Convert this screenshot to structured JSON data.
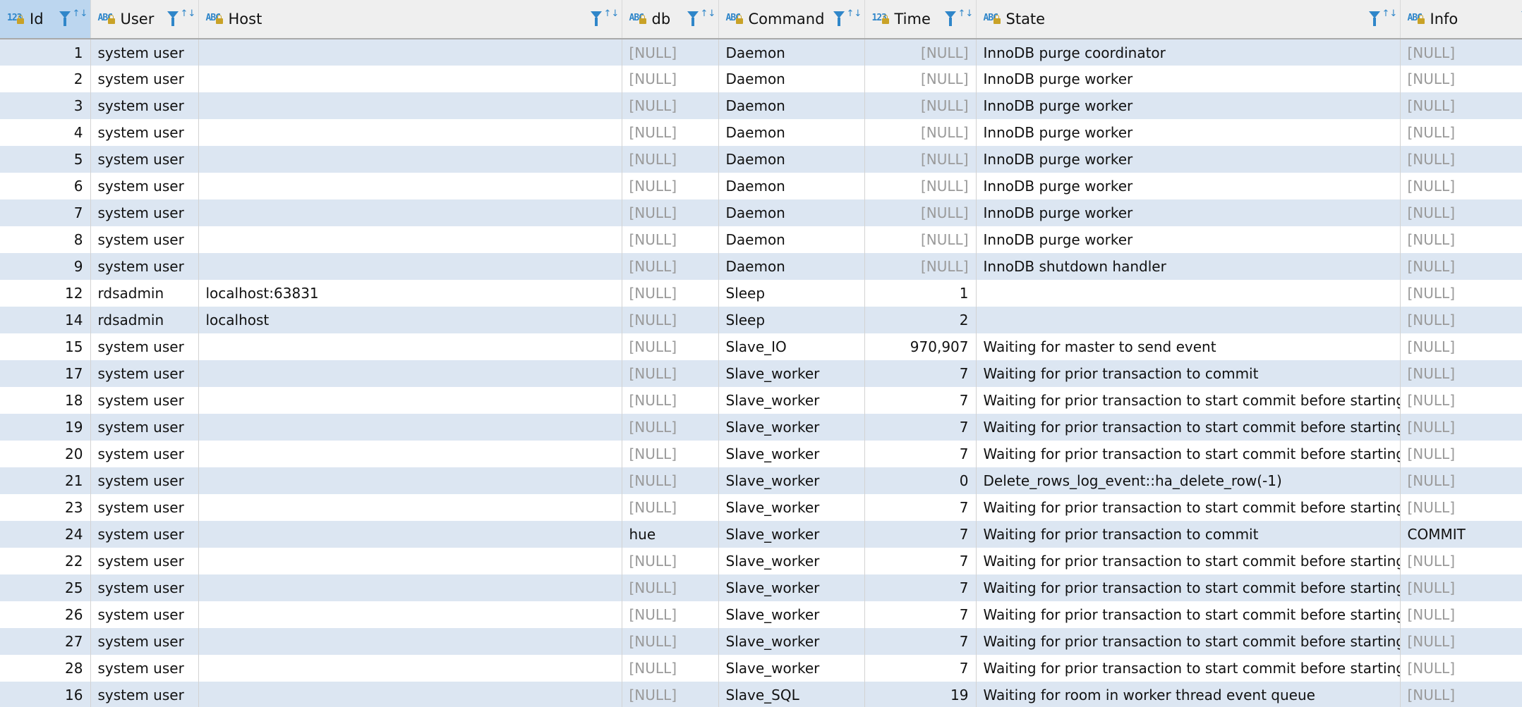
{
  "columns": [
    {
      "key": "id",
      "label": "Id",
      "type_glyph": "123",
      "align": "right",
      "active": true
    },
    {
      "key": "user",
      "label": "User",
      "type_glyph": "ABC",
      "align": "left"
    },
    {
      "key": "host",
      "label": "Host",
      "type_glyph": "ABC",
      "align": "left"
    },
    {
      "key": "db",
      "label": "db",
      "type_glyph": "ABC",
      "align": "left"
    },
    {
      "key": "command",
      "label": "Command",
      "type_glyph": "ABC",
      "align": "left"
    },
    {
      "key": "time",
      "label": "Time",
      "type_glyph": "123",
      "align": "right"
    },
    {
      "key": "state",
      "label": "State",
      "type_glyph": "ABC",
      "align": "left"
    },
    {
      "key": "info",
      "label": "Info",
      "type_glyph": "ABC",
      "align": "left"
    }
  ],
  "null_text": "[NULL]",
  "icons": {
    "lock": "lock-icon",
    "filter": "filter-icon",
    "sort": "sort-icon",
    "sort_arrows": "↑↓"
  },
  "colors": {
    "accent": "#2f86c9",
    "row_alt": "#dce6f2",
    "header_bg": "#efefef",
    "active_header": "#bcd6ef",
    "null_text": "#9a9a9a"
  },
  "rows": [
    {
      "id": "1",
      "user": "system user",
      "host": "",
      "db": null,
      "command": "Daemon",
      "time": null,
      "state": "InnoDB purge coordinator",
      "info": null
    },
    {
      "id": "2",
      "user": "system user",
      "host": "",
      "db": null,
      "command": "Daemon",
      "time": null,
      "state": "InnoDB purge worker",
      "info": null
    },
    {
      "id": "3",
      "user": "system user",
      "host": "",
      "db": null,
      "command": "Daemon",
      "time": null,
      "state": "InnoDB purge worker",
      "info": null
    },
    {
      "id": "4",
      "user": "system user",
      "host": "",
      "db": null,
      "command": "Daemon",
      "time": null,
      "state": "InnoDB purge worker",
      "info": null
    },
    {
      "id": "5",
      "user": "system user",
      "host": "",
      "db": null,
      "command": "Daemon",
      "time": null,
      "state": "InnoDB purge worker",
      "info": null
    },
    {
      "id": "6",
      "user": "system user",
      "host": "",
      "db": null,
      "command": "Daemon",
      "time": null,
      "state": "InnoDB purge worker",
      "info": null
    },
    {
      "id": "7",
      "user": "system user",
      "host": "",
      "db": null,
      "command": "Daemon",
      "time": null,
      "state": "InnoDB purge worker",
      "info": null
    },
    {
      "id": "8",
      "user": "system user",
      "host": "",
      "db": null,
      "command": "Daemon",
      "time": null,
      "state": "InnoDB purge worker",
      "info": null
    },
    {
      "id": "9",
      "user": "system user",
      "host": "",
      "db": null,
      "command": "Daemon",
      "time": null,
      "state": "InnoDB shutdown handler",
      "info": null
    },
    {
      "id": "12",
      "user": "rdsadmin",
      "host": "localhost:63831",
      "db": null,
      "command": "Sleep",
      "time": "1",
      "state": "",
      "info": null
    },
    {
      "id": "14",
      "user": "rdsadmin",
      "host": "localhost",
      "db": null,
      "command": "Sleep",
      "time": "2",
      "state": "",
      "info": null
    },
    {
      "id": "15",
      "user": "system user",
      "host": "",
      "db": null,
      "command": "Slave_IO",
      "time": "970,907",
      "state": "Waiting for master to send event",
      "info": null
    },
    {
      "id": "17",
      "user": "system user",
      "host": "",
      "db": null,
      "command": "Slave_worker",
      "time": "7",
      "state": "Waiting for prior transaction to commit",
      "info": null
    },
    {
      "id": "18",
      "user": "system user",
      "host": "",
      "db": null,
      "command": "Slave_worker",
      "time": "7",
      "state": "Waiting for prior transaction to start commit before starting nex",
      "info": null
    },
    {
      "id": "19",
      "user": "system user",
      "host": "",
      "db": null,
      "command": "Slave_worker",
      "time": "7",
      "state": "Waiting for prior transaction to start commit before starting nex",
      "info": null
    },
    {
      "id": "20",
      "user": "system user",
      "host": "",
      "db": null,
      "command": "Slave_worker",
      "time": "7",
      "state": "Waiting for prior transaction to start commit before starting nex",
      "info": null
    },
    {
      "id": "21",
      "user": "system user",
      "host": "",
      "db": null,
      "command": "Slave_worker",
      "time": "0",
      "state": "Delete_rows_log_event::ha_delete_row(-1)",
      "info": null
    },
    {
      "id": "23",
      "user": "system user",
      "host": "",
      "db": null,
      "command": "Slave_worker",
      "time": "7",
      "state": "Waiting for prior transaction to start commit before starting nex",
      "info": null
    },
    {
      "id": "24",
      "user": "system user",
      "host": "",
      "db": "hue",
      "command": "Slave_worker",
      "time": "7",
      "state": "Waiting for prior transaction to commit",
      "info": "COMMIT"
    },
    {
      "id": "22",
      "user": "system user",
      "host": "",
      "db": null,
      "command": "Slave_worker",
      "time": "7",
      "state": "Waiting for prior transaction to start commit before starting nex",
      "info": null
    },
    {
      "id": "25",
      "user": "system user",
      "host": "",
      "db": null,
      "command": "Slave_worker",
      "time": "7",
      "state": "Waiting for prior transaction to start commit before starting nex",
      "info": null
    },
    {
      "id": "26",
      "user": "system user",
      "host": "",
      "db": null,
      "command": "Slave_worker",
      "time": "7",
      "state": "Waiting for prior transaction to start commit before starting nex",
      "info": null
    },
    {
      "id": "27",
      "user": "system user",
      "host": "",
      "db": null,
      "command": "Slave_worker",
      "time": "7",
      "state": "Waiting for prior transaction to start commit before starting nex",
      "info": null
    },
    {
      "id": "28",
      "user": "system user",
      "host": "",
      "db": null,
      "command": "Slave_worker",
      "time": "7",
      "state": "Waiting for prior transaction to start commit before starting nex",
      "info": null
    },
    {
      "id": "16",
      "user": "system user",
      "host": "",
      "db": null,
      "command": "Slave_SQL",
      "time": "19",
      "state": "Waiting for room in worker thread event queue",
      "info": null
    }
  ]
}
